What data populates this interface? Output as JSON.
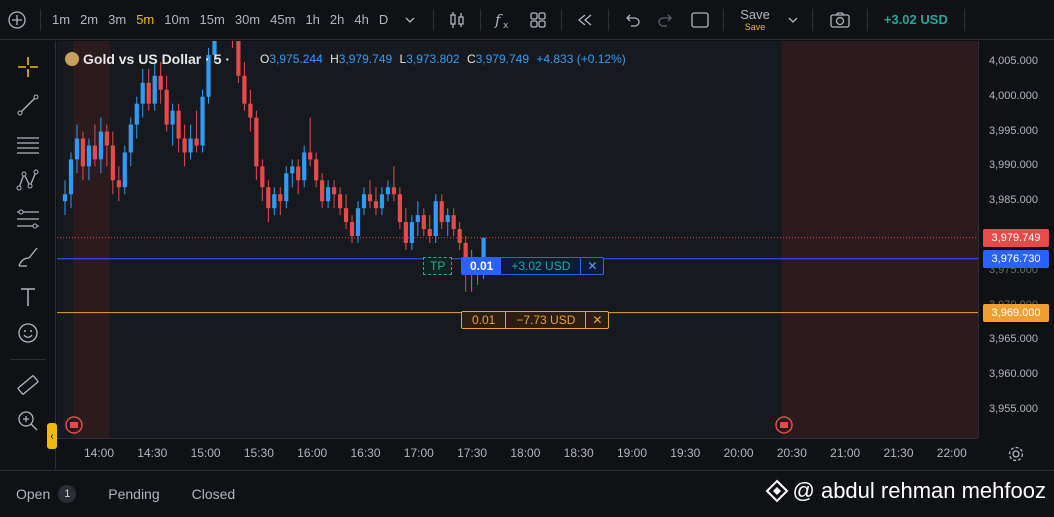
{
  "toolbar": {
    "timeframes": [
      "1m",
      "2m",
      "3m",
      "5m",
      "10m",
      "15m",
      "30m",
      "45m",
      "1h",
      "2h",
      "4h",
      "D"
    ],
    "active_timeframe": "5m",
    "save_label": "Save",
    "save_sub": "Save",
    "pnl": "+3.02 USD"
  },
  "legend": {
    "symbol": "Gold vs US Dollar · 5 ·",
    "o_label": "O",
    "o": "3,975.244",
    "h_label": "H",
    "h": "3,979.749",
    "l_label": "L",
    "l": "3,973.802",
    "c_label": "C",
    "c": "3,979.749",
    "change": "+4.833 (+0.12%)"
  },
  "positions": {
    "tp_tag": "TP",
    "tp_qty": "0.01",
    "tp_pnl": "+3.02 USD",
    "sl_qty": "0.01",
    "sl_pnl": "−7.73 USD",
    "close_glyph": "✕"
  },
  "price_axis": {
    "ticks": [
      "4,005.000",
      "4,000.000",
      "3,995.000",
      "3,990.000",
      "3,985.000",
      "3,965.000",
      "3,960.000",
      "3,955.000"
    ],
    "partial_ticks": [
      "3,975.000",
      "3,970.000"
    ],
    "badges": [
      {
        "label": "3,979.749",
        "color": "#e84a4a"
      },
      {
        "label": "3,976.730",
        "color": "#2962ff"
      },
      {
        "label": "3,969.000",
        "color": "#f0a030"
      }
    ]
  },
  "time_axis": {
    "ticks": [
      "14:00",
      "14:30",
      "15:00",
      "15:30",
      "16:00",
      "16:30",
      "17:00",
      "17:30",
      "18:00",
      "18:30",
      "19:00",
      "19:30",
      "20:00",
      "20:30",
      "21:00",
      "21:30",
      "22:00"
    ]
  },
  "chart_data": {
    "type": "candlestick",
    "symbol": "XAUUSD",
    "ylim": [
      3951,
      4008
    ],
    "candles": [
      [
        3985,
        3988,
        3983,
        3986
      ],
      [
        3986,
        3992,
        3984,
        3991
      ],
      [
        3991,
        3996,
        3989,
        3994
      ],
      [
        3994,
        3995,
        3988,
        3990
      ],
      [
        3990,
        3994,
        3988,
        3993
      ],
      [
        3993,
        3996,
        3990,
        3991
      ],
      [
        3991,
        3997,
        3989,
        3995
      ],
      [
        3995,
        3996,
        3990,
        3993
      ],
      [
        3993,
        3995,
        3986,
        3988
      ],
      [
        3988,
        3990,
        3985,
        3987
      ],
      [
        3987,
        3993,
        3986,
        3992
      ],
      [
        3992,
        3997,
        3990,
        3996
      ],
      [
        3996,
        4000,
        3994,
        3999
      ],
      [
        3999,
        4004,
        3997,
        4002
      ],
      [
        4002,
        4004,
        3998,
        3999
      ],
      [
        3999,
        4005,
        3998,
        4003
      ],
      [
        4003,
        4005,
        3999,
        4001
      ],
      [
        4001,
        4003,
        3995,
        3996
      ],
      [
        3996,
        3999,
        3993,
        3998
      ],
      [
        3998,
        3999,
        3992,
        3994
      ],
      [
        3994,
        3996,
        3990,
        3992
      ],
      [
        3992,
        3996,
        3991,
        3994
      ],
      [
        3994,
        3998,
        3992,
        3993
      ],
      [
        3993,
        4001,
        3992,
        4000
      ],
      [
        4000,
        4007,
        3999,
        4006
      ],
      [
        4006,
        4012,
        4005,
        4010
      ],
      [
        4010,
        4014,
        4008,
        4012
      ],
      [
        4012,
        4013,
        4009,
        4011
      ],
      [
        4011,
        4012,
        4007,
        4008
      ],
      [
        4008,
        4009,
        4002,
        4003
      ],
      [
        4003,
        4005,
        3998,
        3999
      ],
      [
        3999,
        4001,
        3995,
        3997
      ],
      [
        3997,
        3998,
        3988,
        3990
      ],
      [
        3990,
        3991,
        3985,
        3987
      ],
      [
        3987,
        3988,
        3982,
        3984
      ],
      [
        3984,
        3987,
        3983,
        3986
      ],
      [
        3986,
        3987,
        3983,
        3985
      ],
      [
        3985,
        3990,
        3984,
        3989
      ],
      [
        3989,
        3991,
        3987,
        3990
      ],
      [
        3990,
        3991,
        3986,
        3988
      ],
      [
        3988,
        3993,
        3987,
        3992
      ],
      [
        3992,
        3997,
        3990,
        3991
      ],
      [
        3991,
        3992,
        3987,
        3988
      ],
      [
        3988,
        3989,
        3984,
        3985
      ],
      [
        3985,
        3988,
        3984,
        3987
      ],
      [
        3987,
        3988,
        3984,
        3986
      ],
      [
        3986,
        3987,
        3983,
        3984
      ],
      [
        3984,
        3986,
        3981,
        3982
      ],
      [
        3982,
        3983,
        3979,
        3980
      ],
      [
        3980,
        3985,
        3979,
        3984
      ],
      [
        3984,
        3987,
        3983,
        3986
      ],
      [
        3986,
        3988,
        3984,
        3985
      ],
      [
        3985,
        3987,
        3983,
        3984
      ],
      [
        3984,
        3987,
        3983,
        3986
      ],
      [
        3986,
        3988,
        3985,
        3987
      ],
      [
        3987,
        3990,
        3985,
        3986
      ],
      [
        3986,
        3987,
        3981,
        3982
      ],
      [
        3982,
        3984,
        3978,
        3979
      ],
      [
        3979,
        3983,
        3978,
        3982
      ],
      [
        3982,
        3985,
        3980,
        3983
      ],
      [
        3983,
        3984,
        3980,
        3981
      ],
      [
        3981,
        3983,
        3979,
        3980
      ],
      [
        3980,
        3986,
        3979,
        3985
      ],
      [
        3985,
        3986,
        3981,
        3982
      ],
      [
        3982,
        3984,
        3980,
        3983
      ],
      [
        3983,
        3984,
        3980,
        3981
      ],
      [
        3981,
        3982,
        3978,
        3979
      ],
      [
        3979,
        3980,
        3972,
        3975
      ],
      [
        3975,
        3978,
        3972,
        3976
      ],
      [
        3976,
        3977,
        3973,
        3975
      ],
      [
        3975.244,
        3979.749,
        3973.802,
        3979.749
      ]
    ],
    "horizontal_lines": [
      {
        "price": 3979.749,
        "style": "dotted",
        "color": "#e84a4a"
      },
      {
        "price": 3976.73,
        "style": "solid",
        "color": "#2962ff"
      },
      {
        "price": 3969.0,
        "style": "solid",
        "color": "#f0a030"
      }
    ],
    "session_shading": [
      "before 14:00",
      "after 20:30"
    ],
    "up_color": "#2e9cf7",
    "down_color": "#e84a4a"
  },
  "bottom": {
    "tabs": [
      "Open",
      "Pending",
      "Closed"
    ],
    "open_count": "1",
    "watermark": "@ abdul rehman mehfooz"
  }
}
